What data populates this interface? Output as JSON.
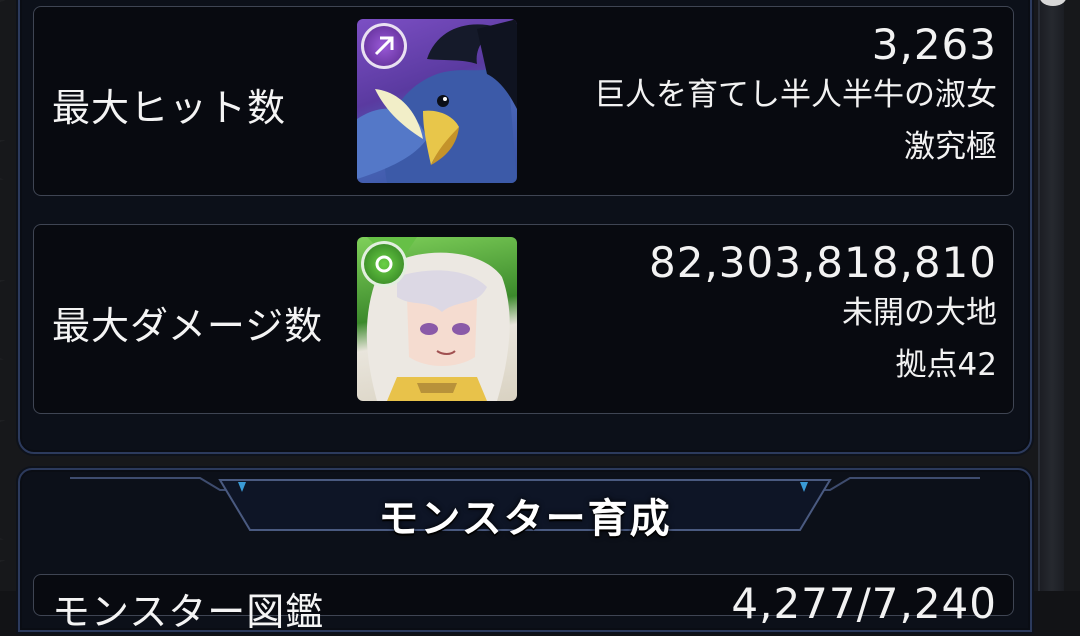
{
  "stats": [
    {
      "label": "最大ヒット数",
      "value": "3,263",
      "quest": "巨人を育てし半人半牛の淑女",
      "difficulty": "激究極",
      "monster_icon": "blue-bird-monster-icon",
      "attribute_icon": "dark-attribute-icon",
      "attribute_color": "#7a3fb8"
    },
    {
      "label": "最大ダメージ数",
      "value": "82,303,818,810",
      "quest": "未開の大地",
      "difficulty": "拠点42",
      "monster_icon": "silver-haired-girl-monster-icon",
      "attribute_icon": "wood-attribute-icon",
      "attribute_color": "#3f9a2e"
    }
  ],
  "section": {
    "title": "モンスター育成"
  },
  "bottom_row": {
    "label": "モンスター図鑑",
    "value": "4,277/7,240"
  },
  "colors": {
    "panel_border": "#2c3a5c",
    "card_background": "#080a10",
    "header_accent": "#3a9bd6"
  }
}
